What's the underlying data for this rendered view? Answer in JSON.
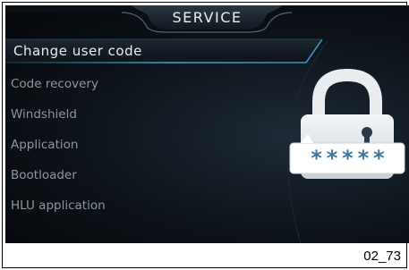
{
  "screen": {
    "title": "SERVICE",
    "menu_items": [
      {
        "label": "Change user code",
        "selected": true
      },
      {
        "label": "Code recovery",
        "selected": false
      },
      {
        "label": "Windshield",
        "selected": false
      },
      {
        "label": "Application",
        "selected": false
      },
      {
        "label": "Bootloader",
        "selected": false
      },
      {
        "label": "HLU application",
        "selected": false
      }
    ],
    "lock_code_mask": "*****",
    "accent_color": "#2ea6d8",
    "icons": [
      "padlock-icon"
    ]
  },
  "figure_label": "02_73"
}
